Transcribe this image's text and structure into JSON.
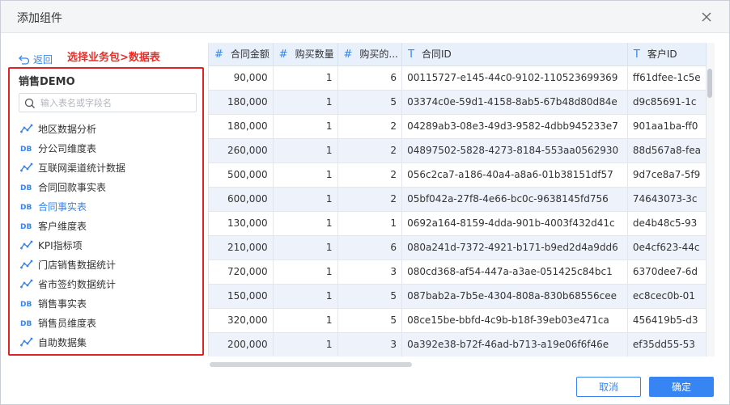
{
  "dialog": {
    "title": "添加组件"
  },
  "back_label": "返回",
  "annotation": "选择业务包>数据表",
  "package": {
    "title": "销售DEMO",
    "search_placeholder": "输入表名或字段名",
    "tables": [
      {
        "label": "地区数据分析",
        "type": "etl-icon"
      },
      {
        "label": "分公司维度表",
        "type": "db-icon"
      },
      {
        "label": "互联网渠道统计数据",
        "type": "etl-icon"
      },
      {
        "label": "合同回款事实表",
        "type": "db-icon"
      },
      {
        "label": "合同事实表",
        "type": "db-icon",
        "selected": true
      },
      {
        "label": "客户维度表",
        "type": "db-icon"
      },
      {
        "label": "KPI指标项",
        "type": "etl-icon"
      },
      {
        "label": "门店销售数据统计",
        "type": "etl-icon"
      },
      {
        "label": "省市签约数据统计",
        "type": "etl-icon"
      },
      {
        "label": "销售事实表",
        "type": "db-icon"
      },
      {
        "label": "销售员维度表",
        "type": "db-icon"
      },
      {
        "label": "自助数据集",
        "type": "etl-icon"
      }
    ]
  },
  "grid": {
    "columns": [
      {
        "type": "#",
        "label": "合同金额"
      },
      {
        "type": "#",
        "label": "购买数量"
      },
      {
        "type": "#",
        "label": "购买的..."
      },
      {
        "type": "T",
        "label": "合同ID"
      },
      {
        "type": "T",
        "label": "客户ID"
      }
    ],
    "rows": [
      [
        "90,000",
        "1",
        "6",
        "00115727-e145-44c0-9102-110523699369",
        "ff61dfee-1c5e"
      ],
      [
        "180,000",
        "1",
        "5",
        "03374c0e-59d1-4158-8ab5-67b48d80d84e",
        "d9c85691-1c"
      ],
      [
        "180,000",
        "1",
        "2",
        "04289ab3-08e3-49d3-9582-4dbb945233e7",
        "901aa1ba-ff0"
      ],
      [
        "260,000",
        "1",
        "2",
        "04897502-5828-4273-8184-553aa0562930",
        "88d567a8-fea"
      ],
      [
        "500,000",
        "1",
        "2",
        "056c2ca7-a186-40a4-a8a6-01b38151df57",
        "9d7ce8a7-5f9"
      ],
      [
        "600,000",
        "1",
        "2",
        "05bf042a-27f8-4e66-bc0c-9638145fd756",
        "74643073-3c"
      ],
      [
        "130,000",
        "1",
        "1",
        "0692a164-8159-4dda-901b-4003f432d41c",
        "de4b48c5-93"
      ],
      [
        "210,000",
        "1",
        "6",
        "080a241d-7372-4921-b171-b9ed2d4a9dd6",
        "0e4cf623-44c"
      ],
      [
        "720,000",
        "1",
        "3",
        "080cd368-af54-447a-a3ae-051425c84bc1",
        "6370dee7-6d"
      ],
      [
        "150,000",
        "1",
        "5",
        "087bab2a-7b5e-4304-808a-830b68556cee",
        "ec8cec0b-01"
      ],
      [
        "320,000",
        "1",
        "5",
        "08ce15be-bbfd-4c9b-b18f-39eb03e471ca",
        "456419b5-d3"
      ],
      [
        "200,000",
        "1",
        "3",
        "0a392e38-b72f-46ad-b713-a19e06f6f46e",
        "ef35dd55-53"
      ]
    ]
  },
  "buttons": {
    "cancel": "取消",
    "ok": "确定"
  },
  "colors": {
    "accent": "#3685f2",
    "highlight": "#e02424",
    "header_bg": "#e8f0fb"
  }
}
